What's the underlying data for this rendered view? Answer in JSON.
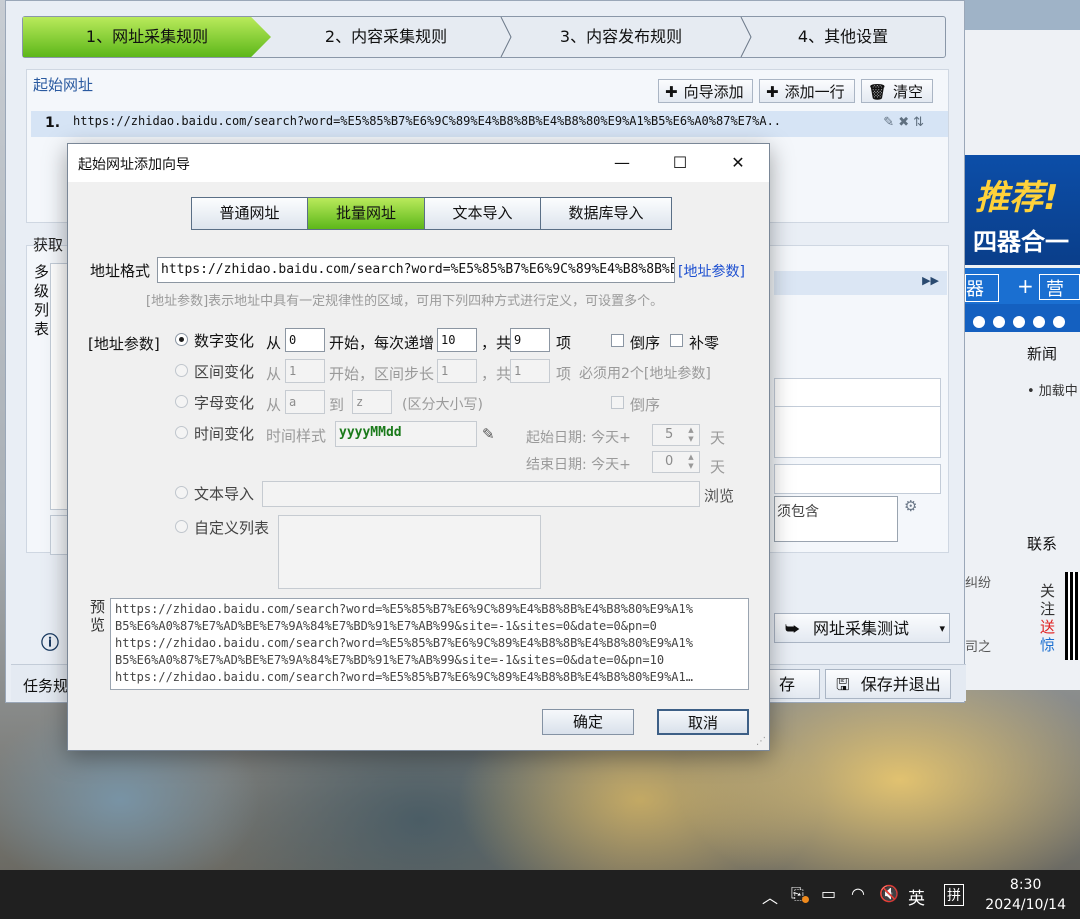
{
  "steps": [
    "1、网址采集规则",
    "2、内容采集规则",
    "3、内容发布规则",
    "4、其他设置"
  ],
  "main": {
    "start_url_title": "起始网址",
    "toolbar": {
      "wizard_add": "向导添加",
      "add_row": "添加一行",
      "clear": "清空"
    },
    "url_row": {
      "num": "1.",
      "url": "https://zhidao.baidu.com/search?word=%E5%85%B7%E6%9C%89%E4%B8%8B%E4%B8%80%E9%A1%B5%E6%A0%87%E7%A.."
    },
    "fetch_title": "获取",
    "side_label": "多级列表",
    "contains_label": "须包含",
    "url_test_button": "网址采集测试",
    "bottom_left": "任务规",
    "save_partial": "存",
    "save_exit_button": "保存并退出"
  },
  "dialog": {
    "title": "起始网址添加向导",
    "tabs": [
      "普通网址",
      "批量网址",
      "文本导入",
      "数据库导入"
    ],
    "active_tab": 1,
    "url_format_label": "地址格式",
    "url_format_value": "https://zhidao.baidu.com/search?word=%E5%85%B7%E6%9C%89%E4%B8%8B%E4%B8%80%E9%A1%B5",
    "addr_param_link": "[地址参数]",
    "hint": "[地址参数]表示地址中具有一定规律性的区域，可用下列四种方式进行定义，可设置多个。",
    "param_label": "[地址参数]",
    "numeric": {
      "label": "数字变化",
      "from_label": "从",
      "from": "0",
      "start_label": "开始，每次递增",
      "step": "10",
      "total_label": "，共",
      "count": "9",
      "unit": "项",
      "reverse": "倒序",
      "zero_pad": "补零"
    },
    "range": {
      "label": "区间变化",
      "from_label": "从",
      "from": "1",
      "start_label": "开始，区间步长",
      "step": "1",
      "total_label": "，共",
      "count": "1",
      "unit": "项",
      "note": "必须用2个[地址参数]"
    },
    "letter": {
      "label": "字母变化",
      "from_label": "从",
      "from": "a",
      "to_label": "到",
      "to": "z",
      "note": "(区分大小写)",
      "reverse": "倒序"
    },
    "time": {
      "label": "时间变化",
      "style_label": "时间样式",
      "style_value": "yyyyMMdd",
      "start_label": "起始日期: 今天+",
      "start_value": "5",
      "end_label": "结束日期: 今天+",
      "end_value": "0",
      "day": "天"
    },
    "text_import": {
      "label": "文本导入",
      "browse": "浏览"
    },
    "custom_list": {
      "label": "自定义列表"
    },
    "preview_label": "预览",
    "preview_lines": [
      "https://zhidao.baidu.com/search?word=%E5%85%B7%E6%9C%89%E4%B8%8B%E4%B8%80%E9%A1%",
      "B5%E6%A0%87%E7%AD%BE%E7%9A%84%E7%BD%91%E7%AB%99&site=-1&sites=0&date=0&pn=0",
      "https://zhidao.baidu.com/search?word=%E5%85%B7%E6%9C%89%E4%B8%8B%E4%B8%80%E9%A1%",
      "B5%E6%A0%87%E7%AD%BE%E7%9A%84%E7%BD%91%E7%AB%99&site=-1&sites=0&date=0&pn=10",
      "https://zhidao.baidu.com/search?word=%E5%85%B7%E6%9C%89%E4%B8%8B%E4%B8%80%E9%A1…"
    ],
    "ok": "确定",
    "cancel": "取消"
  },
  "background_browser": {
    "banner_line1": "推荐!",
    "banner_line2": "四器合一",
    "nav_left": "器",
    "nav_plus": "+",
    "nav_right": "营",
    "news": "新闻",
    "loading": "• 加载中",
    "contact": "联系",
    "side_text_1": "纠纷",
    "side_text_2": "司之",
    "follow_1": "关注",
    "follow_2": "送",
    "follow_3": "惊"
  },
  "taskbar": {
    "ime_lang": "英",
    "ime_mode": "拼",
    "time": "8:30",
    "date": "2024/10/14"
  },
  "colors": {
    "active_green": "#7ccb2c",
    "link_blue": "#1d4fd0",
    "taskbar": "#202020"
  }
}
